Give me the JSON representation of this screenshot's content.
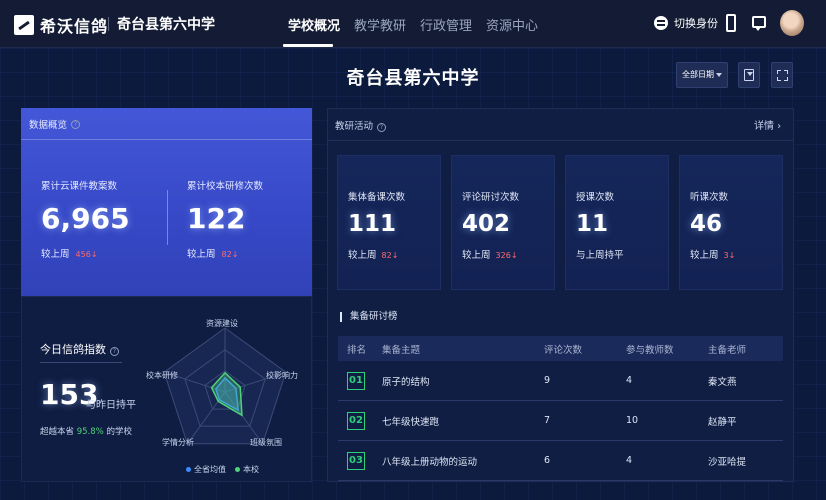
{
  "app": {
    "logo_text": "希沃信鸽",
    "school": "奇台县第六中学"
  },
  "nav": {
    "tabs": [
      {
        "label": "学校概况",
        "active": true
      },
      {
        "label": "教学教研",
        "active": false
      },
      {
        "label": "行政管理",
        "active": false
      },
      {
        "label": "资源中心",
        "active": false
      }
    ],
    "switch_identity": "切换身份"
  },
  "header": {
    "title": "奇台县第六中学",
    "date_filter": "全部日期"
  },
  "overview": {
    "title": "数据概览",
    "metrics": [
      {
        "label": "累计云课件教案数",
        "value": "6,965",
        "compare_prefix": "较上周",
        "delta": "456"
      },
      {
        "label": "累计校本研修次数",
        "value": "122",
        "compare_prefix": "较上周",
        "delta": "82"
      }
    ]
  },
  "index": {
    "title": "今日信鸽指数",
    "value": "153",
    "trend": "与昨日持平",
    "beat_prefix": "超越本省",
    "beat_pct": "95.8%",
    "beat_suffix": "的学校",
    "radar_axes": [
      "资源建设",
      "校影响力",
      "班级氛围",
      "学情分析",
      "校本研修"
    ],
    "series": [
      {
        "name": "全省均值",
        "color": "#3d8cff",
        "values": [
          0.22,
          0.18,
          0.35,
          0.15,
          0.15
        ]
      },
      {
        "name": "本校",
        "color": "#4fd37a",
        "values": [
          0.3,
          0.25,
          0.45,
          0.18,
          0.22
        ]
      }
    ]
  },
  "research": {
    "title": "教研活动",
    "more": "详情",
    "stats": [
      {
        "label": "集体备课次数",
        "value": "111",
        "compare": "较上周",
        "delta": "82"
      },
      {
        "label": "评论研讨次数",
        "value": "402",
        "compare": "较上周",
        "delta": "326"
      },
      {
        "label": "授课次数",
        "value": "11",
        "compare": "与上周持平",
        "delta": ""
      },
      {
        "label": "听课次数",
        "value": "46",
        "compare": "较上周",
        "delta": "3"
      }
    ],
    "ranking": {
      "title": "集备研讨榜",
      "headers": [
        "排名",
        "集备主题",
        "评论次数",
        "参与教师数",
        "主备老师"
      ],
      "rows": [
        {
          "rank": "01",
          "topic": "原子的结构",
          "comments": "9",
          "teachers": "4",
          "lead": "秦文燕"
        },
        {
          "rank": "02",
          "topic": "七年级快速跑",
          "comments": "7",
          "teachers": "10",
          "lead": "赵静平"
        },
        {
          "rank": "03",
          "topic": "八年级上册动物的运动",
          "comments": "6",
          "teachers": "4",
          "lead": "沙亚哈提"
        }
      ]
    }
  }
}
